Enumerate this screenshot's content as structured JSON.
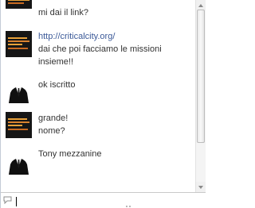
{
  "chat": {
    "messages": [
      {
        "avatar": "logo-avatar",
        "lines": [
          "mi dai il link?"
        ]
      },
      {
        "avatar": "logo-avatar",
        "link": "http://criticalcity.org/",
        "lines": [
          "dai che poi facciamo le missioni",
          "insieme!!"
        ]
      },
      {
        "avatar": "suit-avatar",
        "lines": [
          "ok iscritto"
        ]
      },
      {
        "avatar": "logo-avatar",
        "lines": [
          "grande!",
          "nome?"
        ]
      },
      {
        "avatar": "suit-avatar",
        "lines": [
          "Tony mezzanine"
        ]
      }
    ]
  },
  "input": {
    "value": "",
    "placeholder": "",
    "icon": "speech-bubble-icon"
  },
  "colors": {
    "link": "#3b5998",
    "text": "#333333",
    "border": "#c4cbd6",
    "logo_bg": "#161616",
    "logo_accent": "#e8a13a"
  }
}
